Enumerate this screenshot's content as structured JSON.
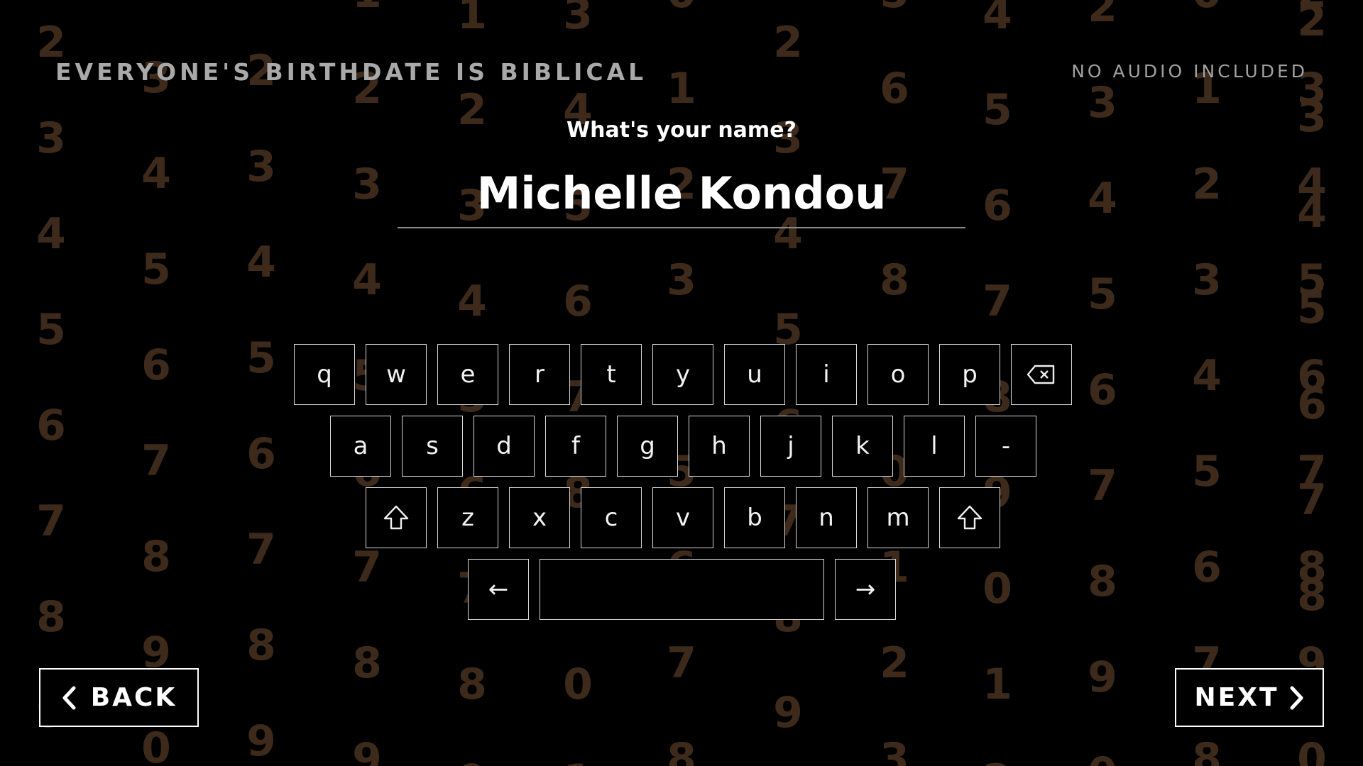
{
  "header": {
    "title": "EVERYONE'S BIRTHDATE IS BIBLICAL",
    "audio_note": "NO AUDIO INCLUDED"
  },
  "form": {
    "prompt": "What's your name?",
    "name_value": "Michelle Kondou"
  },
  "keyboard": {
    "row1": [
      "q",
      "w",
      "e",
      "r",
      "t",
      "y",
      "u",
      "i",
      "o",
      "p"
    ],
    "row2": [
      "a",
      "s",
      "d",
      "f",
      "g",
      "h",
      "j",
      "k",
      "l",
      "-"
    ],
    "row3": [
      "z",
      "x",
      "c",
      "v",
      "b",
      "n",
      "m"
    ],
    "backspace_icon": "backspace-icon",
    "shift_icon": "shift-icon",
    "cursor_left": "←",
    "cursor_right": "→"
  },
  "nav": {
    "back_label": "BACK",
    "next_label": "NEXT"
  },
  "background": {
    "digit_color": "#3d2a1b",
    "columns": [
      "23456789",
      "345678901",
      "234567890123",
      "1234567890123",
      "123456789012345",
      "345678901234",
      "012345678901",
      "234567890",
      "567890123456",
      "456789012345",
      "234567890",
      "012345678",
      "234567890",
      "23456789"
    ]
  },
  "colors": {
    "background": "#000000",
    "title": "#a9a9a9",
    "key_border": "#d8d8d8",
    "underline": "#8c8c8c"
  }
}
